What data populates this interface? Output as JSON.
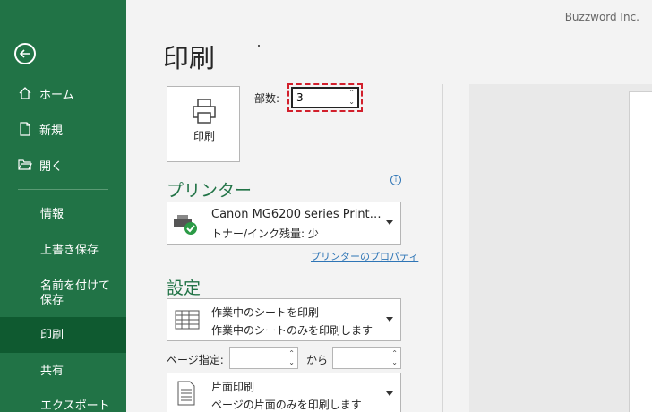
{
  "brand": "Buzzword Inc.",
  "sidebar": {
    "items": [
      {
        "label": "ホーム",
        "icon": "home-icon"
      },
      {
        "label": "新規",
        "icon": "new-document-icon"
      },
      {
        "label": "開く",
        "icon": "open-folder-icon"
      }
    ],
    "sub_items": [
      "情報",
      "上書き保存",
      "名前を付けて保存",
      "印刷",
      "共有",
      "エクスポート"
    ],
    "active": "印刷"
  },
  "main": {
    "title": "印刷",
    "print_button_label": "印刷",
    "copies_label": "部数:",
    "copies_value": "3",
    "printer_section": "プリンター",
    "printer": {
      "name": "Canon MG6200 series Print…",
      "status": "トナー/インク残量: 少"
    },
    "printer_properties_link": "プリンターのプロパティ",
    "settings_section": "設定",
    "print_range": {
      "title": "作業中のシートを印刷",
      "desc": "作業中のシートのみを印刷します"
    },
    "pages_label": "ページ指定:",
    "pages_from": "",
    "pages_to_label": "から",
    "pages_to": "",
    "sides": {
      "title": "片面印刷",
      "desc": "ページの片面のみを印刷します"
    }
  },
  "colors": {
    "accent": "#217346",
    "highlight": "#d21f2b",
    "link": "#2e75b6"
  }
}
